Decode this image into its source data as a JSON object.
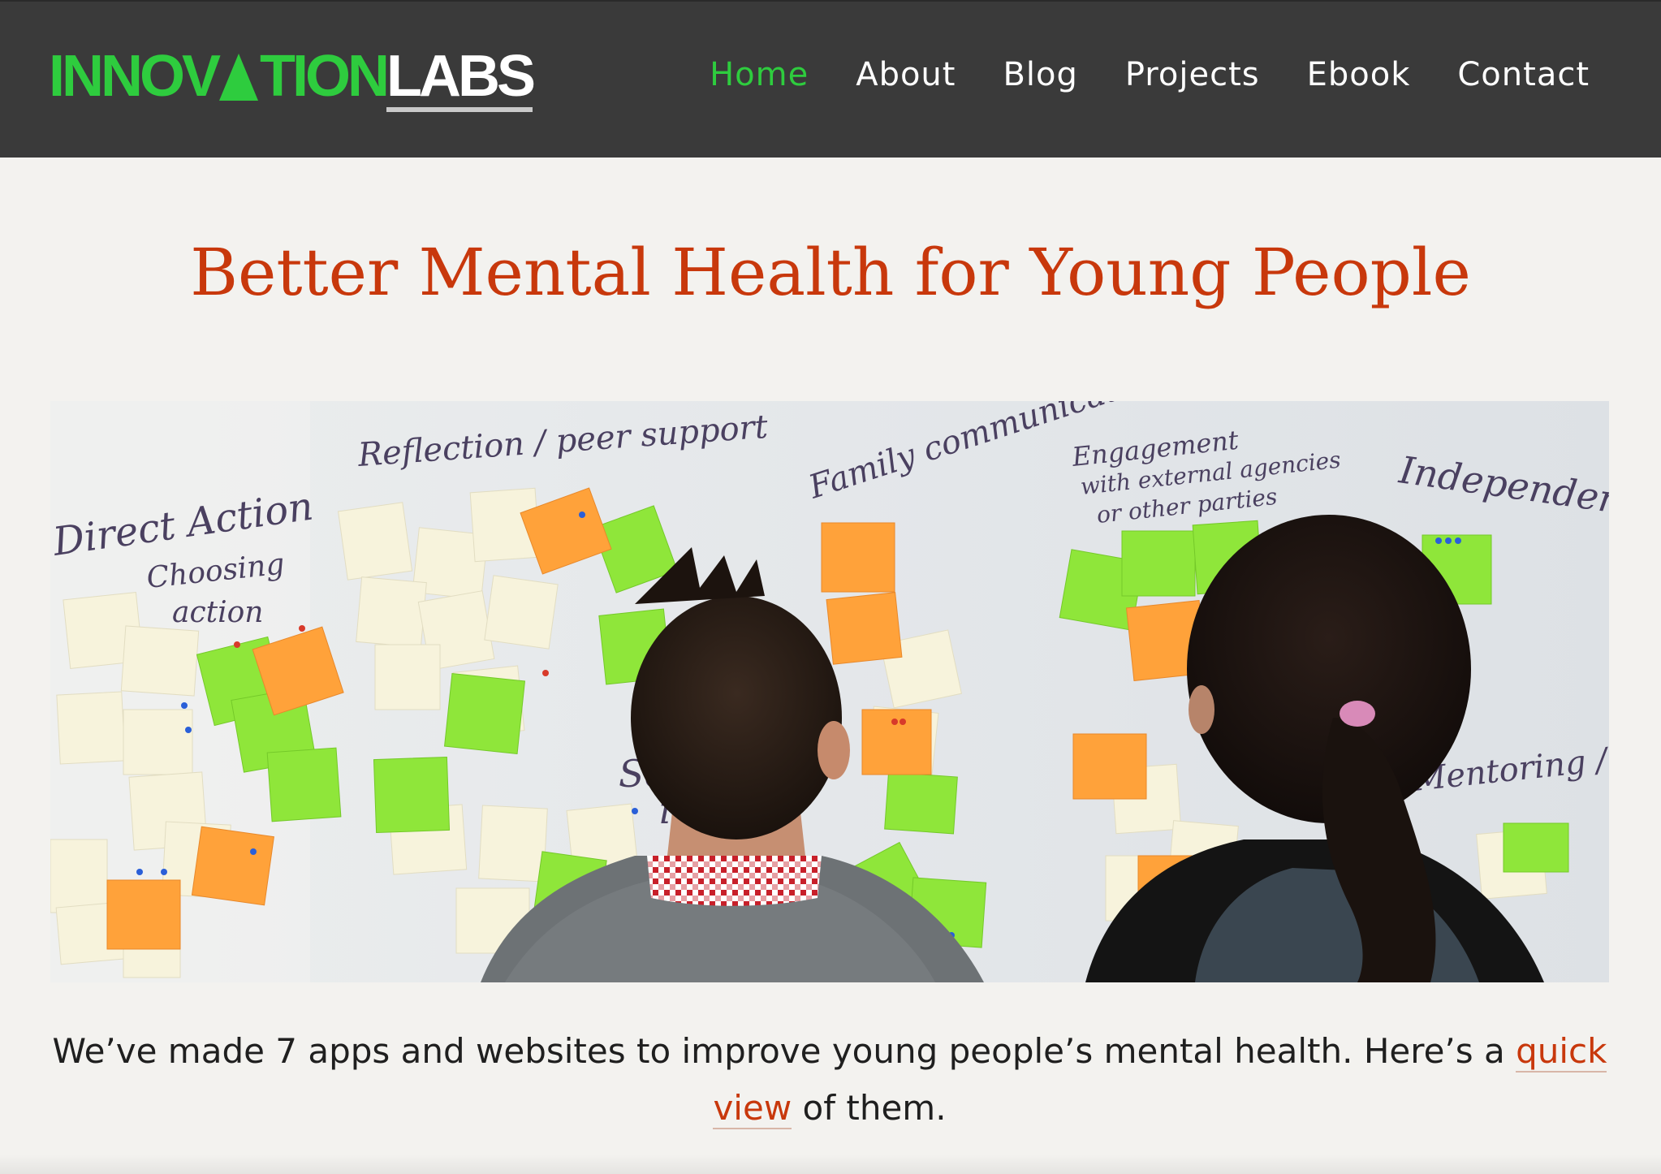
{
  "header": {
    "logo": {
      "part_innovation_before": "INNOV",
      "part_innovation_after": "TION",
      "part_labs": "LABS",
      "triangle_icon": "triangle-a-icon"
    },
    "nav": [
      {
        "label": "Home",
        "active": true
      },
      {
        "label": "About",
        "active": false
      },
      {
        "label": "Blog",
        "active": false
      },
      {
        "label": "Projects",
        "active": false
      },
      {
        "label": "Ebook",
        "active": false
      },
      {
        "label": "Contact",
        "active": false
      }
    ]
  },
  "main": {
    "headline": "Better Mental Health for Young People",
    "hero_image": {
      "wall_labels": {
        "reflection": "Reflection / peer support",
        "family": "Family communication",
        "engagement_1": "Engagement",
        "engagement_2": "with external agencies",
        "engagement_3": "or other parties",
        "independence": "Independence",
        "direct_1": "Direct Action",
        "direct_2": "Choosing",
        "direct_3": "action",
        "mentoring": "Mentoring / Sha",
        "soc": "Soc",
        "id": "id"
      }
    },
    "intro": {
      "text_before": "We’ve made 7 apps and websites to improve young people’s mental health. Here’s a ",
      "link_text": "quick view",
      "text_after": " of them."
    }
  },
  "colors": {
    "header_bg": "#3a3a3a",
    "brand_green": "#2ecc3e",
    "accent_orange": "#c8380c",
    "page_bg": "#f3f2ef"
  }
}
